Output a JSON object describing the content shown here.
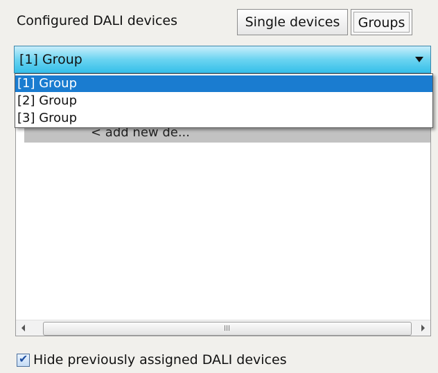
{
  "panel": {
    "title": "Configured DALI devices"
  },
  "toggle": {
    "single_label": "Single devices",
    "groups_label": "Groups"
  },
  "combo": {
    "selected_value": "[1] Group",
    "options": [
      "[1] Group",
      "[2] Group",
      "[3] Group"
    ]
  },
  "list": {
    "rows": [
      {
        "label": "< add new de..."
      }
    ]
  },
  "footer": {
    "hide_assigned_label": "Hide previously assigned DALI devices",
    "hide_assigned_checked": true,
    "check_glyph": "✔"
  },
  "scrollbar": {
    "grip_glyph": "III"
  },
  "colors": {
    "combo_accent": "#35bfe9",
    "selection": "#1a7cd0"
  }
}
